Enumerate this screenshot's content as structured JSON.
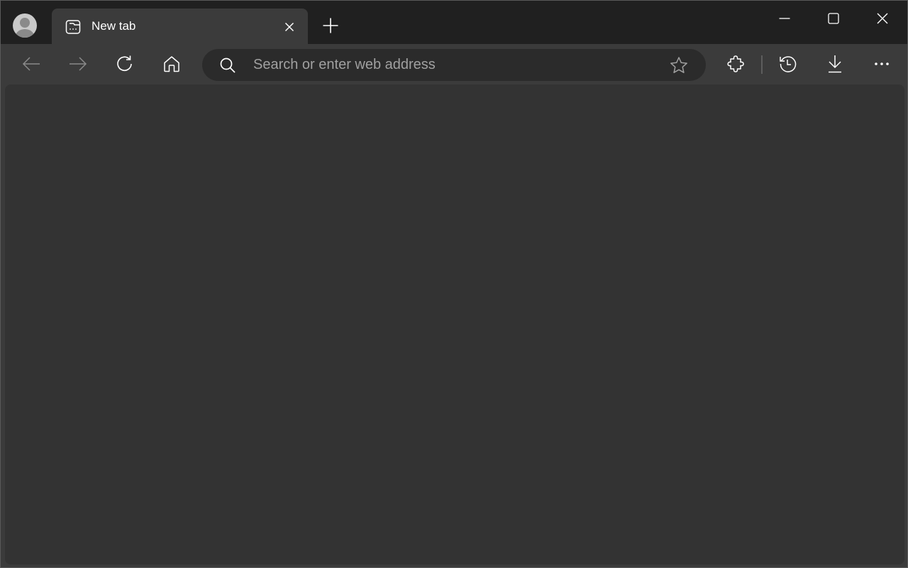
{
  "browser": {
    "profile": {
      "icon": "profile-avatar-icon"
    },
    "tabs": [
      {
        "title": "New tab",
        "icon": "new-tab-page-icon",
        "active": true
      }
    ],
    "new_tab_icon": "plus-icon",
    "window_controls": {
      "minimize": "minimize-icon",
      "maximize": "maximize-icon",
      "close": "close-icon"
    },
    "toolbar": {
      "back_icon": "arrow-left-icon",
      "forward_icon": "arrow-right-icon",
      "refresh_icon": "refresh-icon",
      "home_icon": "home-icon",
      "address_bar": {
        "value": "",
        "placeholder": "Search or enter web address",
        "search_icon": "search-icon",
        "favorite_icon": "star-icon"
      },
      "extensions_icon": "puzzle-piece-icon",
      "history_icon": "history-icon",
      "downloads_icon": "download-icon",
      "menu_icon": "more-horizontal-icon"
    }
  },
  "colors": {
    "titlebar": "#202020",
    "toolbar": "#3b3b3b",
    "address_bar": "#2b2b2b",
    "content": "#333333",
    "icon": "#ffffff",
    "icon_disabled": "#8a8a8a",
    "placeholder": "#a0a0a0"
  }
}
